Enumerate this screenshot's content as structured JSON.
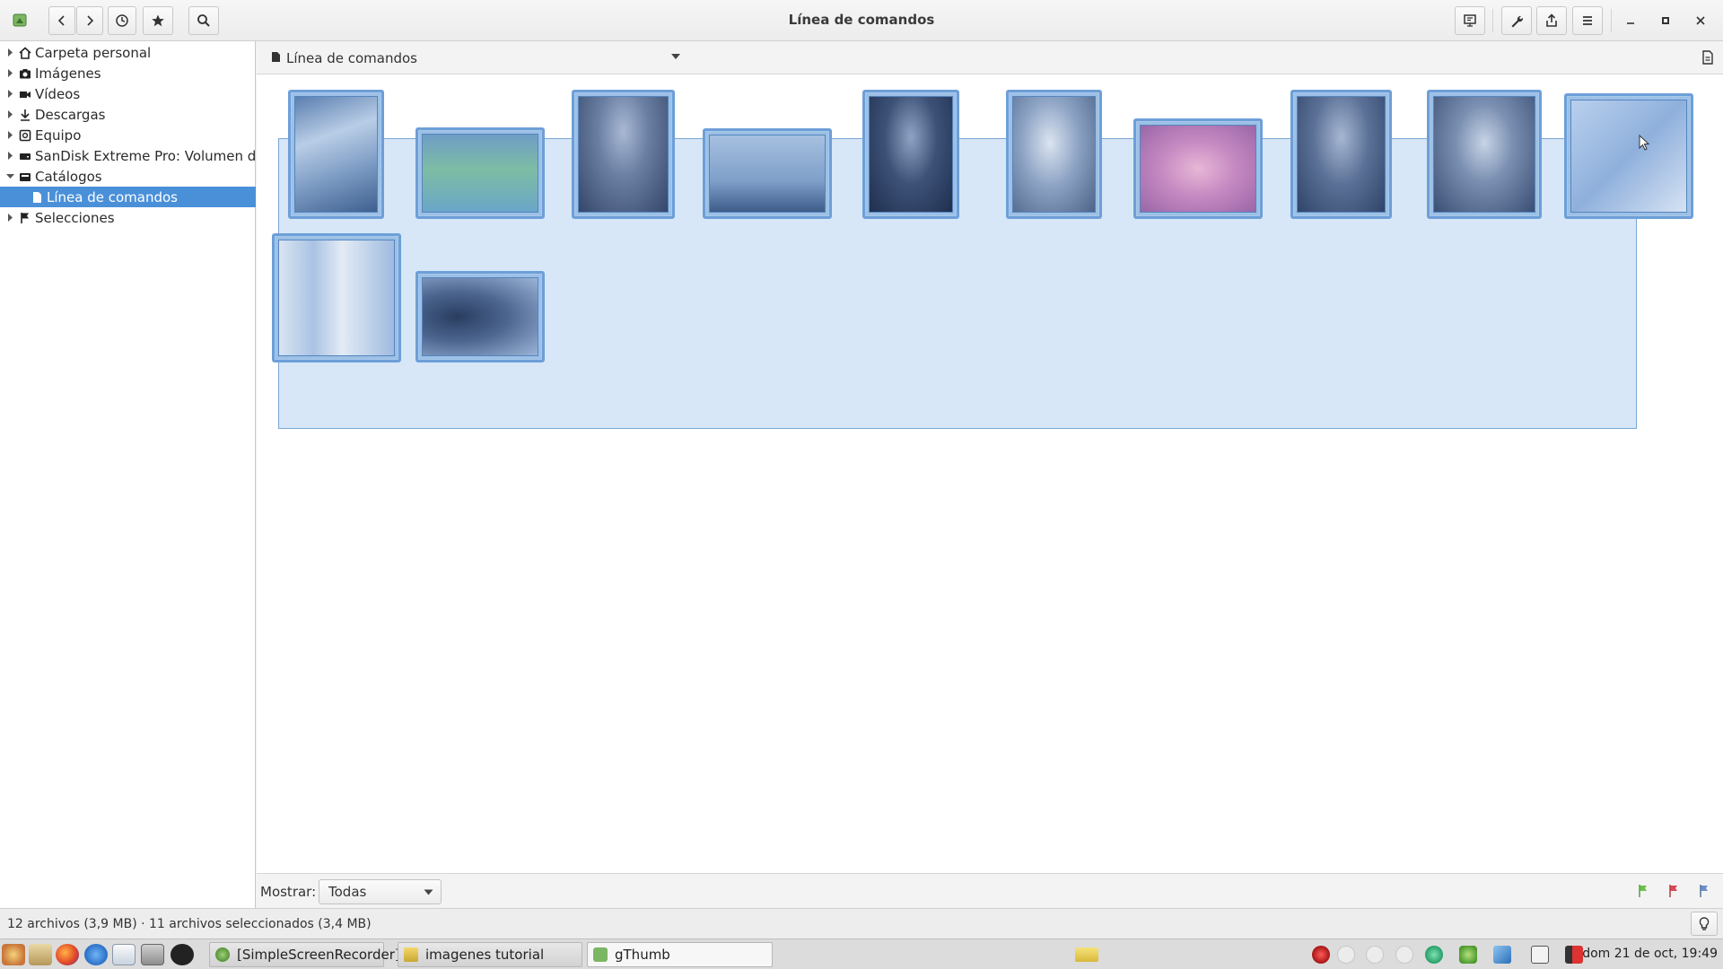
{
  "window": {
    "title": "Línea de comandos"
  },
  "sidebar": {
    "items": [
      {
        "label": "Carpeta personal",
        "icon": "home-icon"
      },
      {
        "label": "Imágenes",
        "icon": "camera-icon"
      },
      {
        "label": "Vídeos",
        "icon": "video-camera-icon"
      },
      {
        "label": "Descargas",
        "icon": "download-icon"
      },
      {
        "label": "Equipo",
        "icon": "computer-icon"
      },
      {
        "label": "SanDisk Extreme Pro: Volumen d...",
        "icon": "drive-icon"
      },
      {
        "label": "Catálogos",
        "icon": "catalog-icon"
      },
      {
        "label": "Línea de comandos",
        "icon": "catalog-file-icon"
      },
      {
        "label": "Selecciones",
        "icon": "flag-icon"
      }
    ]
  },
  "location": {
    "label": "Línea de comandos"
  },
  "filter": {
    "label": "Mostrar:",
    "selected": "Todas"
  },
  "status": {
    "text": "12 archivos (3,9 MB) · 11 archivos seleccionados (3,4 MB)"
  },
  "taskbar": {
    "tasks": [
      {
        "label": "[SimpleScreenRecorder]"
      },
      {
        "label": "imagenes tutorial"
      },
      {
        "label": "gThumb"
      }
    ],
    "clock": "dom 21 de oct, 19:49"
  },
  "colors": {
    "accent": "#4a90d9",
    "selection_fill": "#9cc0e6"
  }
}
